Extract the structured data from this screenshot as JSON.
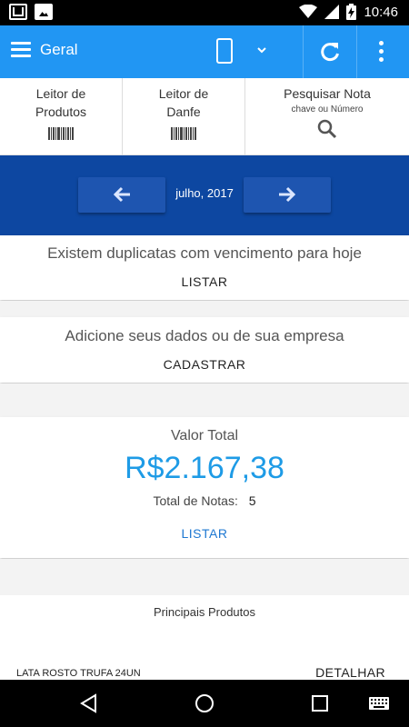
{
  "status_bar": {
    "time": "10:46",
    "icons": [
      "gmail-icon",
      "image-icon",
      "wifi-icon",
      "signal-icon",
      "battery-charging-icon"
    ]
  },
  "app_bar": {
    "title": "Geral",
    "icons": [
      "menu-icon",
      "phone-icon",
      "chevron-down-icon",
      "refresh-icon",
      "more-vert-icon"
    ],
    "color": "#2196f3"
  },
  "shortcuts": [
    {
      "label_line1": "Leitor de",
      "label_line2": "Produtos",
      "sub": "",
      "icon": "barcode-icon"
    },
    {
      "label_line1": "Leitor de",
      "label_line2": "Danfe",
      "sub": "",
      "icon": "barcode-icon"
    },
    {
      "label_line1": "Pesquisar Nota",
      "label_line2": "",
      "sub": "chave ou Número",
      "icon": "search-icon"
    }
  ],
  "month_nav": {
    "label": "julho, 2017",
    "color": "#0d47a1"
  },
  "duplicates_card": {
    "message": "Existem duplicatas com vencimento para hoje",
    "action": "LISTAR"
  },
  "register_card": {
    "message": "Adicione seus dados ou de sua empresa",
    "action": "CADASTRAR"
  },
  "total_card": {
    "label": "Valor Total",
    "value": "R$2.167,38",
    "notes_label": "Total de Notas:",
    "notes_count": "5",
    "action": "LISTAR",
    "value_color": "#1e9be6"
  },
  "products_card": {
    "title": "Principais Produtos",
    "product_name": "LATA ROSTO TRUFA 24UN",
    "action": "DETALHAR"
  },
  "nav_bar": {
    "icons": [
      "back-icon",
      "home-icon",
      "recents-icon",
      "keyboard-icon"
    ]
  }
}
